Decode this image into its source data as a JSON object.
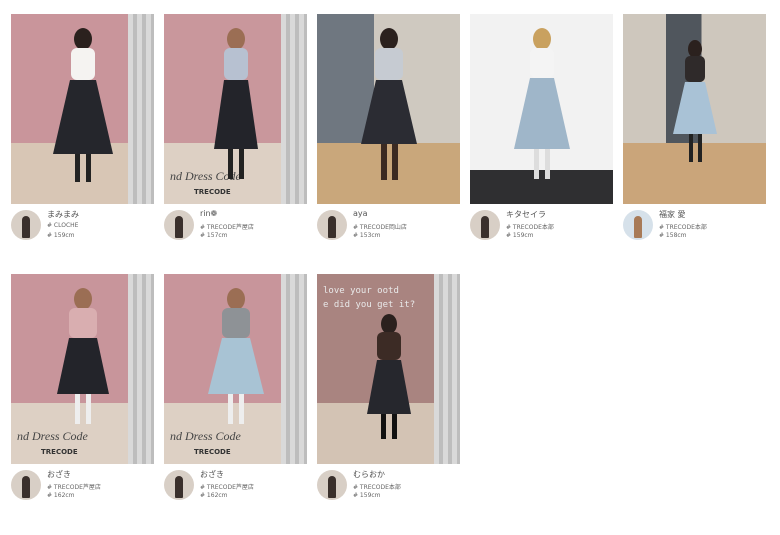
{
  "cards": [
    {
      "name": "まみまみ",
      "tag": "# CLOCHE",
      "height": "# 159cm"
    },
    {
      "name": "rin❁",
      "tag": "# TRECODE芦屋店",
      "height": "# 157cm"
    },
    {
      "name": "aya",
      "tag": "# TRECODE岡山店",
      "height": "# 153cm"
    },
    {
      "name": "キタセイラ",
      "tag": "# TRECODE本部",
      "height": "# 159cm"
    },
    {
      "name": "福家 愛",
      "tag": "# TRECODE本部",
      "height": "# 158cm"
    },
    {
      "name": "おざき",
      "tag": "# TRECODE芦屋店",
      "height": "# 162cm"
    },
    {
      "name": "おざき",
      "tag": "# TRECODE芦屋店",
      "height": "# 162cm"
    },
    {
      "name": "むらおか",
      "tag": "# TRECODE本部",
      "height": "# 159cm"
    }
  ],
  "overlays": {
    "dress_code": "nd Dress Code",
    "trecode": "TRECODE",
    "neon_line1": "love your ootd",
    "neon_line2": "e did you get it?"
  }
}
